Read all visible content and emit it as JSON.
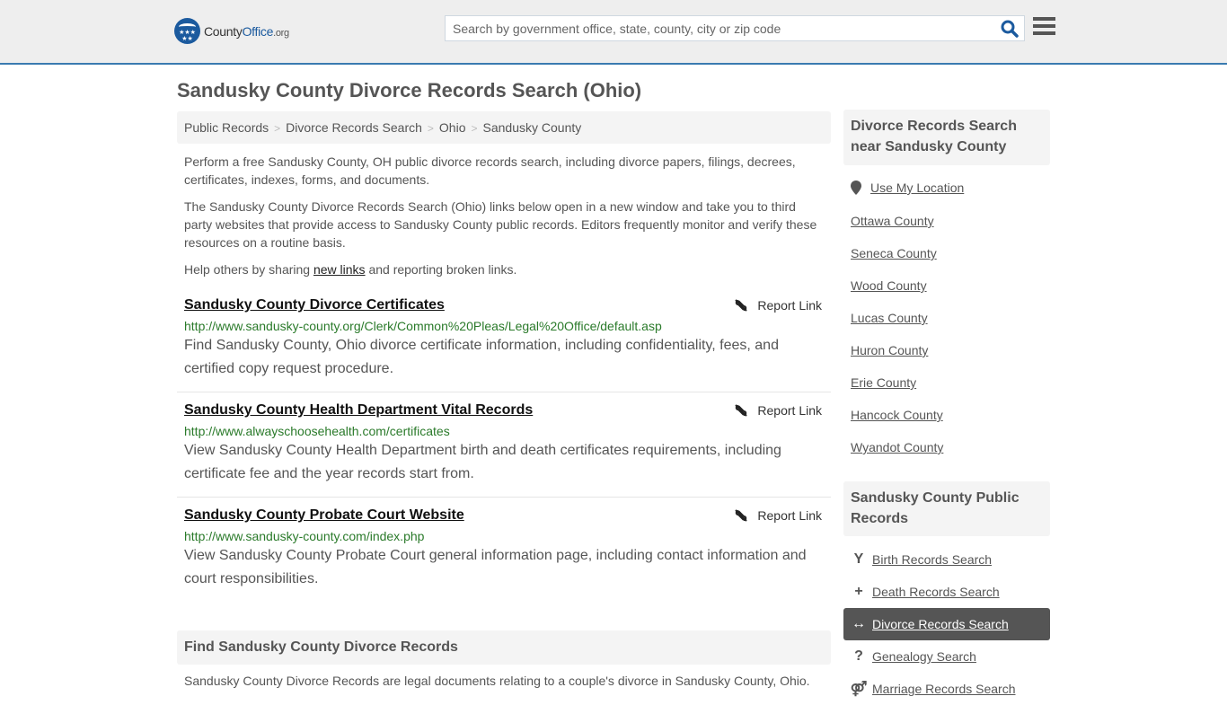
{
  "header": {
    "logo_brand_prefix": "County",
    "logo_brand": "Office",
    "logo_tld": ".org",
    "search_placeholder": "Search by government office, state, county, city or zip code",
    "search_icon": "search-icon",
    "menu_icon": "hamburger-menu-icon"
  },
  "page": {
    "title": "Sandusky County Divorce Records Search (Ohio)"
  },
  "breadcrumb": [
    {
      "label": "Public Records"
    },
    {
      "label": "Divorce Records Search"
    },
    {
      "label": "Ohio"
    },
    {
      "label": "Sandusky County"
    }
  ],
  "intro": {
    "p1": "Perform a free Sandusky County, OH public divorce records search, including divorce papers, filings, decrees, certificates, indexes, forms, and documents.",
    "p2": "The Sandusky County Divorce Records Search (Ohio) links below open in a new window and take you to third party websites that provide access to Sandusky County public records. Editors frequently monitor and verify these resources on a routine basis.",
    "p3_prefix": "Help others by sharing ",
    "p3_link": "new links",
    "p3_suffix": " and reporting broken links."
  },
  "results": [
    {
      "title": "Sandusky County Divorce Certificates",
      "url": "http://www.sandusky-county.org/Clerk/Common%20Pleas/Legal%20Office/default.asp",
      "description": "Find Sandusky County, Ohio divorce certificate information, including confidentiality, fees, and certified copy request procedure.",
      "report_label": "Report Link"
    },
    {
      "title": "Sandusky County Health Department Vital Records",
      "url": "http://www.alwayschoosehealth.com/certificates",
      "description": "View Sandusky County Health Department birth and death certificates requirements, including certificate fee and the year records start from.",
      "report_label": "Report Link"
    },
    {
      "title": "Sandusky County Probate Court Website",
      "url": "http://www.sandusky-county.com/index.php",
      "description": "View Sandusky County Probate Court general information page, including contact information and court responsibilities.",
      "report_label": "Report Link"
    }
  ],
  "find_section": {
    "heading": "Find Sandusky County Divorce Records",
    "text": "Sandusky County Divorce Records are legal documents relating to a couple's divorce in Sandusky County, Ohio."
  },
  "sidebar": {
    "nearby_heading": "Divorce Records Search near Sandusky County",
    "use_location": "Use My Location",
    "nearby": [
      {
        "label": "Ottawa County"
      },
      {
        "label": "Seneca County"
      },
      {
        "label": "Wood County"
      },
      {
        "label": "Lucas County"
      },
      {
        "label": "Huron County"
      },
      {
        "label": "Erie County"
      },
      {
        "label": "Hancock County"
      },
      {
        "label": "Wyandot County"
      }
    ],
    "public_heading": "Sandusky County Public Records",
    "public_records": [
      {
        "label": "Birth Records Search",
        "icon": "child-icon",
        "glyph": "Y",
        "active": false
      },
      {
        "label": "Death Records Search",
        "icon": "plus-icon",
        "glyph": "+",
        "active": false
      },
      {
        "label": "Divorce Records Search",
        "icon": "arrows-horizontal-icon",
        "glyph": "↔",
        "active": true
      },
      {
        "label": "Genealogy Search",
        "icon": "question-icon",
        "glyph": "?",
        "active": false
      },
      {
        "label": "Marriage Records Search",
        "icon": "marriage-icon",
        "glyph": "⚤",
        "active": false
      }
    ]
  },
  "colors": {
    "header_bg": "#eeeeee",
    "header_border": "#3a7bb0",
    "brand_blue": "#1b5a9e",
    "url_green": "#2a7a2a",
    "active_item_bg": "#555555"
  }
}
